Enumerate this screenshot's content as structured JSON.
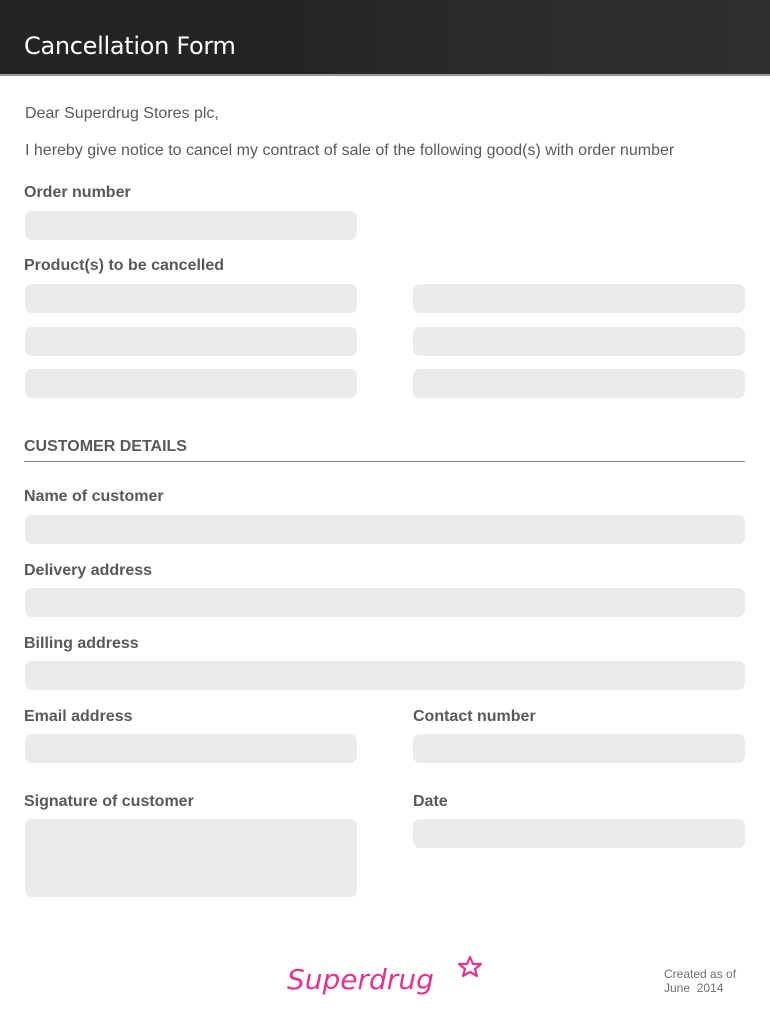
{
  "header": {
    "title": "Cancellation Form"
  },
  "intro": {
    "greeting": "Dear Superdrug Stores plc,",
    "notice": "I hereby give notice to cancel my contract of sale of the following good(s) with order number"
  },
  "fields": {
    "order_number": "Order number",
    "products": "Product(s) to be cancelled",
    "customer_name": "Name of customer",
    "delivery_address": "Delivery address",
    "billing_address": "Billing address",
    "email": "Email address",
    "contact_number": "Contact number",
    "signature": "Signature of customer",
    "date": "Date"
  },
  "section": {
    "customer_details": "CUSTOMER DETAILS"
  },
  "footer": {
    "brand": "Superdrug",
    "brand_color": "#e6338c",
    "created_line1": "Created as of",
    "created_line2": "June  2014"
  }
}
